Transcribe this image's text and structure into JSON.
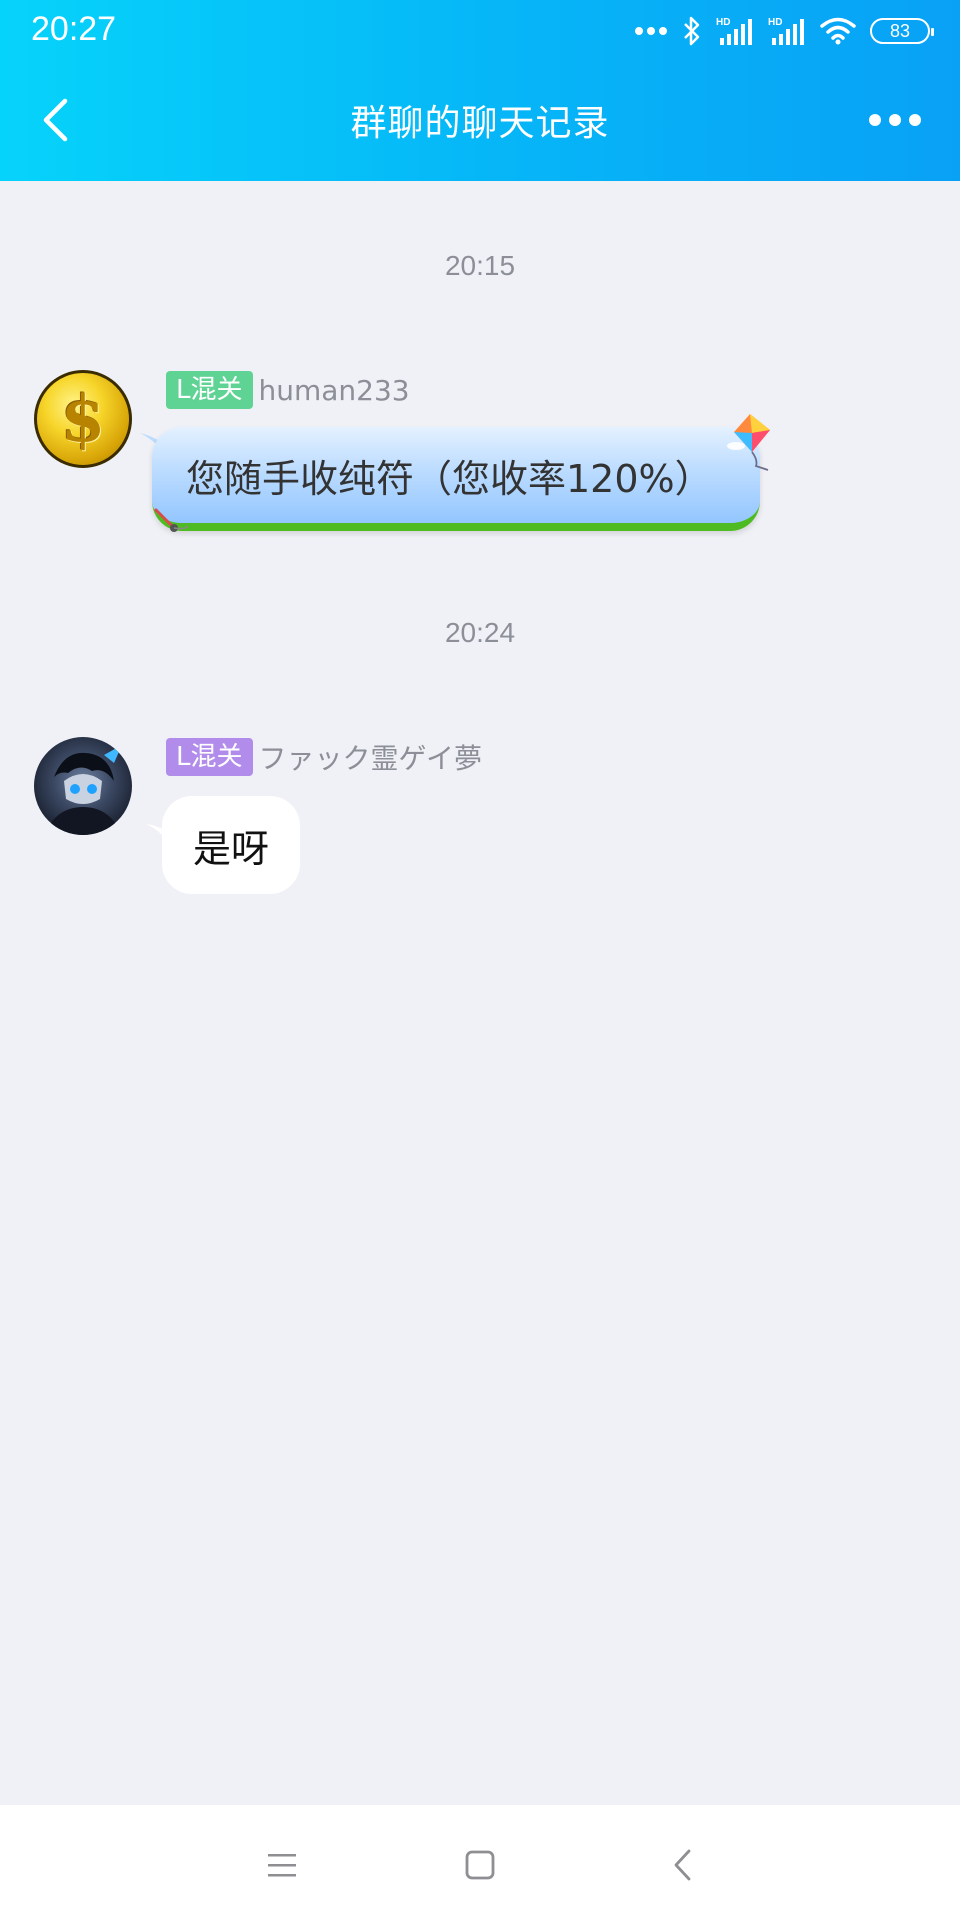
{
  "status_bar": {
    "time": "20:27",
    "battery": "83",
    "icons": [
      "more-dots-icon",
      "bluetooth-icon",
      "signal-hd-icon",
      "signal-hd-icon",
      "wifi-icon",
      "battery-icon"
    ]
  },
  "header": {
    "title": "群聊的聊天记录",
    "back_icon": "chevron-left-icon",
    "more_icon": "more-horizontal-icon"
  },
  "messages": [
    {
      "timestamp": "20:15",
      "badge": "L混关",
      "badge_color": "#5fd394",
      "sender": "human233",
      "avatar": "gold-coin-avatar",
      "text": "您随手收纯符（您收率120%）",
      "bubble_style": "kite-theme"
    },
    {
      "timestamp": "20:24",
      "badge": "L混关",
      "badge_color": "#b28ceb",
      "sender": "ファック霊ゲイ夢",
      "avatar": "anime-character-avatar",
      "text": "是呀",
      "bubble_style": "plain-white"
    }
  ],
  "system_nav": {
    "icons": [
      "menu-icon",
      "home-square-icon",
      "back-triangle-icon"
    ]
  },
  "colors": {
    "header_gradient_start": "#06d3fb",
    "header_gradient_end": "#09a1f6",
    "background": "#f0f1f6",
    "meta_text": "#8c8f98"
  }
}
